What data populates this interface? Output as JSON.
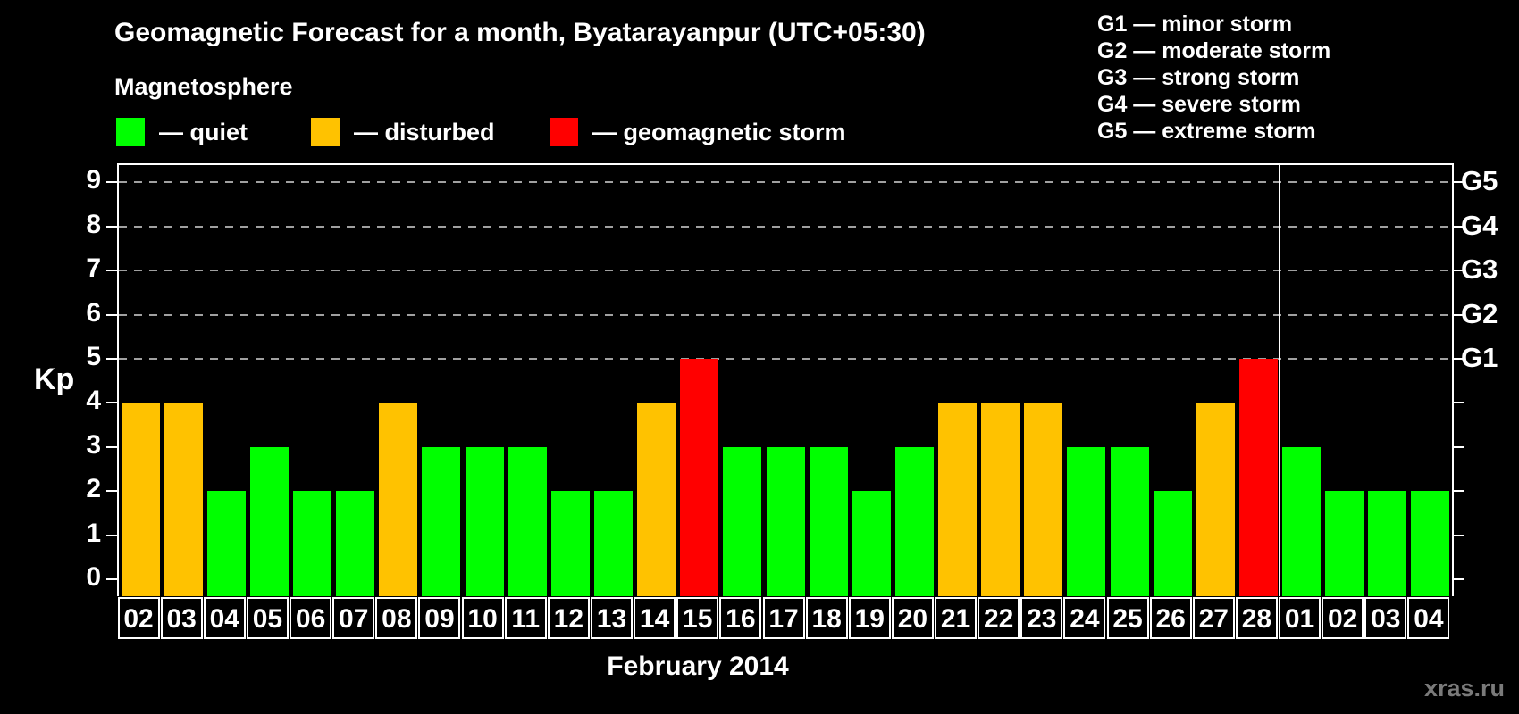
{
  "title": "Geomagnetic Forecast for a month, Byatarayanpur (UTC+05:30)",
  "legend": {
    "heading": "Magnetosphere",
    "items": [
      {
        "key": "quiet",
        "label": "— quiet"
      },
      {
        "key": "disturbed",
        "label": "— disturbed"
      },
      {
        "key": "storm",
        "label": "— geomagnetic storm"
      }
    ]
  },
  "storm_scale": [
    "G1 — minor storm",
    "G2 — moderate storm",
    "G3 — strong storm",
    "G4 — severe storm",
    "G5 — extreme storm"
  ],
  "colors": {
    "quiet": "#00ff00",
    "disturbed": "#ffc200",
    "storm": "#ff0000",
    "grid": "#a0a0a0",
    "axis": "#ffffff",
    "background": "#000000",
    "watermark": "#7a7a7a"
  },
  "chart_data": {
    "type": "bar",
    "title": "Geomagnetic Forecast for a month, Byatarayanpur (UTC+05:30)",
    "ylabel": "Kp",
    "xlabel": "February 2014",
    "ylim": [
      0,
      9
    ],
    "grid": "horizontal dashed lines at Kp 5,6,7,8,9 only",
    "legend_position": "top-left",
    "categories": [
      "02",
      "03",
      "04",
      "05",
      "06",
      "07",
      "08",
      "09",
      "10",
      "11",
      "12",
      "13",
      "14",
      "15",
      "16",
      "17",
      "18",
      "19",
      "20",
      "21",
      "22",
      "23",
      "24",
      "25",
      "26",
      "27",
      "28",
      "01",
      "02",
      "03",
      "04"
    ],
    "values": [
      4,
      4,
      2,
      3,
      2,
      2,
      4,
      3,
      3,
      3,
      2,
      2,
      4,
      5,
      3,
      3,
      3,
      2,
      3,
      4,
      4,
      4,
      3,
      3,
      2,
      4,
      5,
      3,
      2,
      2,
      2
    ],
    "status": [
      "disturbed",
      "disturbed",
      "quiet",
      "quiet",
      "quiet",
      "quiet",
      "disturbed",
      "quiet",
      "quiet",
      "quiet",
      "quiet",
      "quiet",
      "disturbed",
      "storm",
      "quiet",
      "quiet",
      "quiet",
      "quiet",
      "quiet",
      "disturbed",
      "disturbed",
      "disturbed",
      "quiet",
      "quiet",
      "quiet",
      "disturbed",
      "storm",
      "quiet",
      "quiet",
      "quiet",
      "quiet"
    ],
    "right_axis_labels": [
      {
        "kp": 5,
        "label": "G1"
      },
      {
        "kp": 6,
        "label": "G2"
      },
      {
        "kp": 7,
        "label": "G3"
      },
      {
        "kp": 8,
        "label": "G4"
      },
      {
        "kp": 9,
        "label": "G5"
      }
    ],
    "month_separator_after_index": 26
  },
  "watermark": "xras.ru"
}
